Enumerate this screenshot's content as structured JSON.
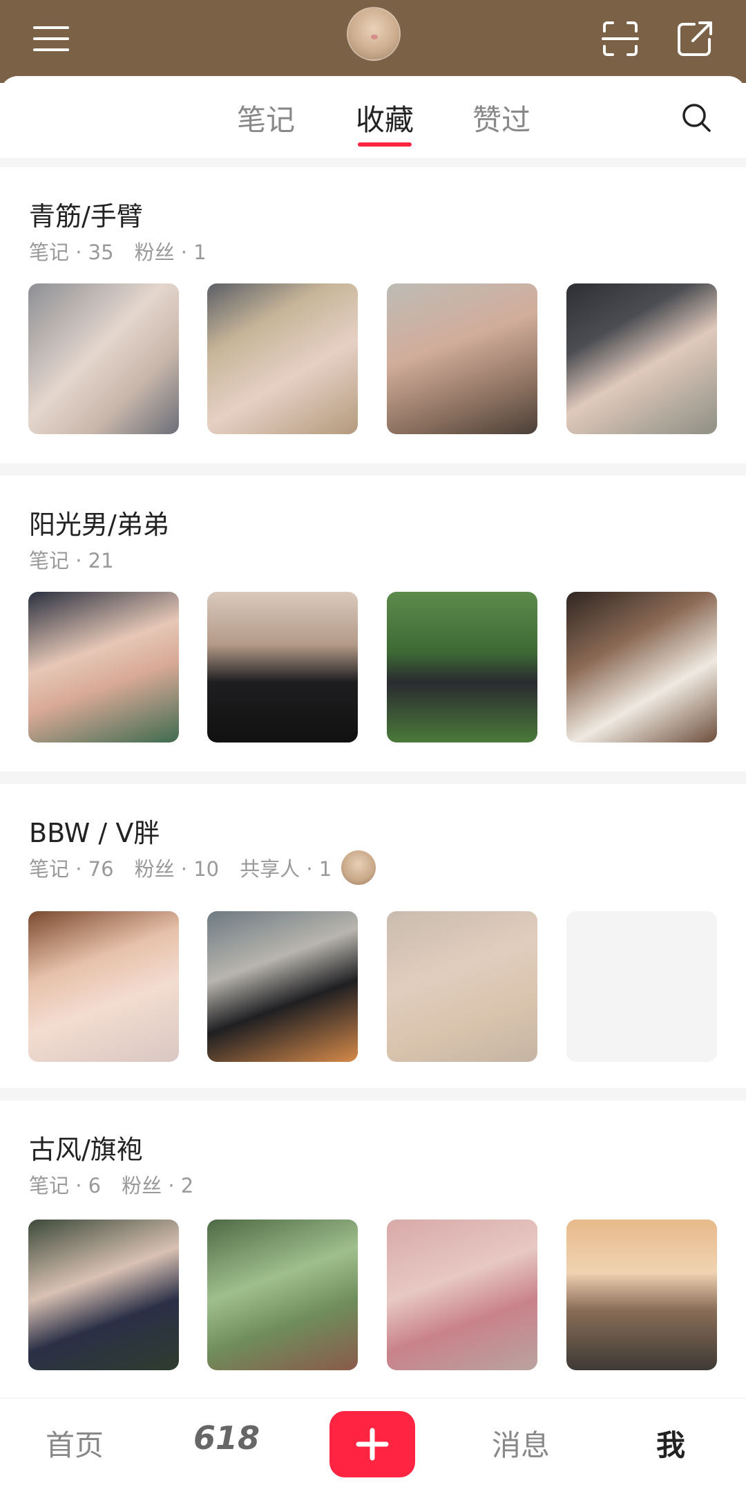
{
  "top_bar": {
    "menu_icon": "menu-icon",
    "avatar_icon": "profile-avatar",
    "scan_icon": "scan-icon",
    "share_icon": "share-icon",
    "background": "#7b6246"
  },
  "tabs": {
    "items": [
      {
        "label": "笔记"
      },
      {
        "label": "收藏",
        "active": true
      },
      {
        "label": "赞过"
      }
    ],
    "accent": "#ff2442",
    "search_icon": "search-icon"
  },
  "boards": [
    {
      "title": "青筋/手臂",
      "notes": "笔记 · 35",
      "followers": "粉丝 · 1"
    },
    {
      "title": "阳光男/弟弟",
      "notes": "笔记 · 21"
    },
    {
      "title": "BBW / V胖",
      "notes": "笔记 · 76",
      "followers": "粉丝 · 10",
      "sharers": "共享人 · 1"
    },
    {
      "title": "古风/旗袍",
      "notes": "笔记 · 6",
      "followers": "粉丝 · 2"
    }
  ],
  "bottom_nav": {
    "home": "首页",
    "promo": "618",
    "add_icon": "plus-icon",
    "messages": "消息",
    "me": "我"
  }
}
